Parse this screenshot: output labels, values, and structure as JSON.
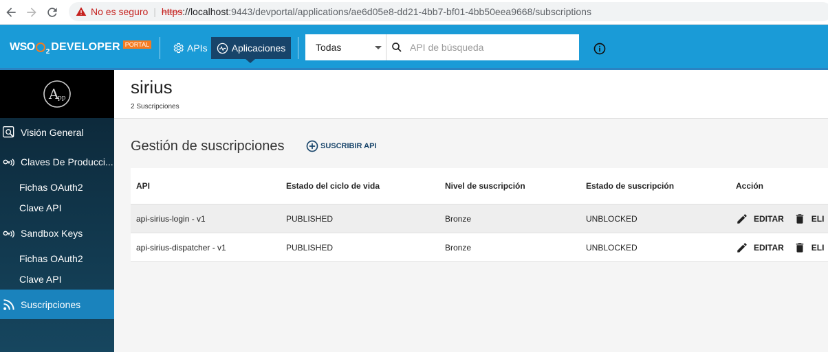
{
  "browser": {
    "security_label": "No es seguro",
    "url_protocol": "https",
    "url_host": "://localhost",
    "url_path": ":9443/devportal/applications/ae6d05e8-dd21-4bb7-bf01-4bb50eea9668/subscriptions"
  },
  "header": {
    "logo_wso": "WSO",
    "logo_2": "2",
    "logo_developer": "DEVELOPER",
    "logo_portal": "PORTAL",
    "nav_apis": "APIs",
    "nav_apps": "Aplicaciones",
    "search_select": "Todas",
    "search_placeholder": "API de búsqueda"
  },
  "sidebar": {
    "items": [
      {
        "label": "Visión General",
        "icon": "overview-search-icon"
      },
      {
        "label": "Claves De Producci...",
        "icon": "production-keys-icon"
      },
      {
        "label": "Fichas OAuth2"
      },
      {
        "label": "Clave API"
      },
      {
        "label": "Sandbox Keys",
        "icon": "sandbox-keys-icon"
      },
      {
        "label": "Fichas OAuth2"
      },
      {
        "label": "Clave API"
      },
      {
        "label": "Suscripciones",
        "icon": "subscriptions-rss-icon",
        "active": true
      }
    ]
  },
  "main": {
    "app_name": "sirius",
    "subscription_count": "2 Suscripciones",
    "section_title": "Gestión de suscripciones",
    "subscribe_button": "SUSCRIBIR API",
    "table": {
      "headers": [
        "API",
        "Estado del ciclo de vida",
        "Nivel de suscripción",
        "Estado de suscripción",
        "Acción"
      ],
      "rows": [
        [
          "api-sirius-login - v1",
          "PUBLISHED",
          "Bronze",
          "UNBLOCKED"
        ],
        [
          "api-sirius-dispatcher - v1",
          "PUBLISHED",
          "Bronze",
          "UNBLOCKED"
        ]
      ],
      "edit_label": "EDITAR",
      "delete_label": "ELI"
    }
  },
  "colors": {
    "header_blue": "#1a9bd7",
    "nav_active": "#17446a",
    "sidebar_active": "#1a83bd",
    "brand_orange": "#f47b20"
  }
}
